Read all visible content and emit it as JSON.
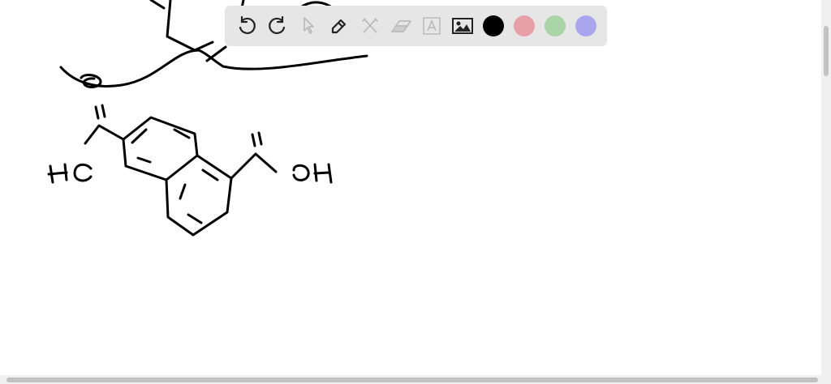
{
  "toolbar": {
    "tools": [
      "undo-icon",
      "redo-icon",
      "select-icon",
      "pen-icon",
      "tools-icon",
      "eraser-icon",
      "text-icon",
      "image-icon"
    ],
    "colors": [
      "#000000",
      "#e8a0a8",
      "#a8d4a8",
      "#aaa6ee"
    ],
    "selected_color": "#000000"
  }
}
